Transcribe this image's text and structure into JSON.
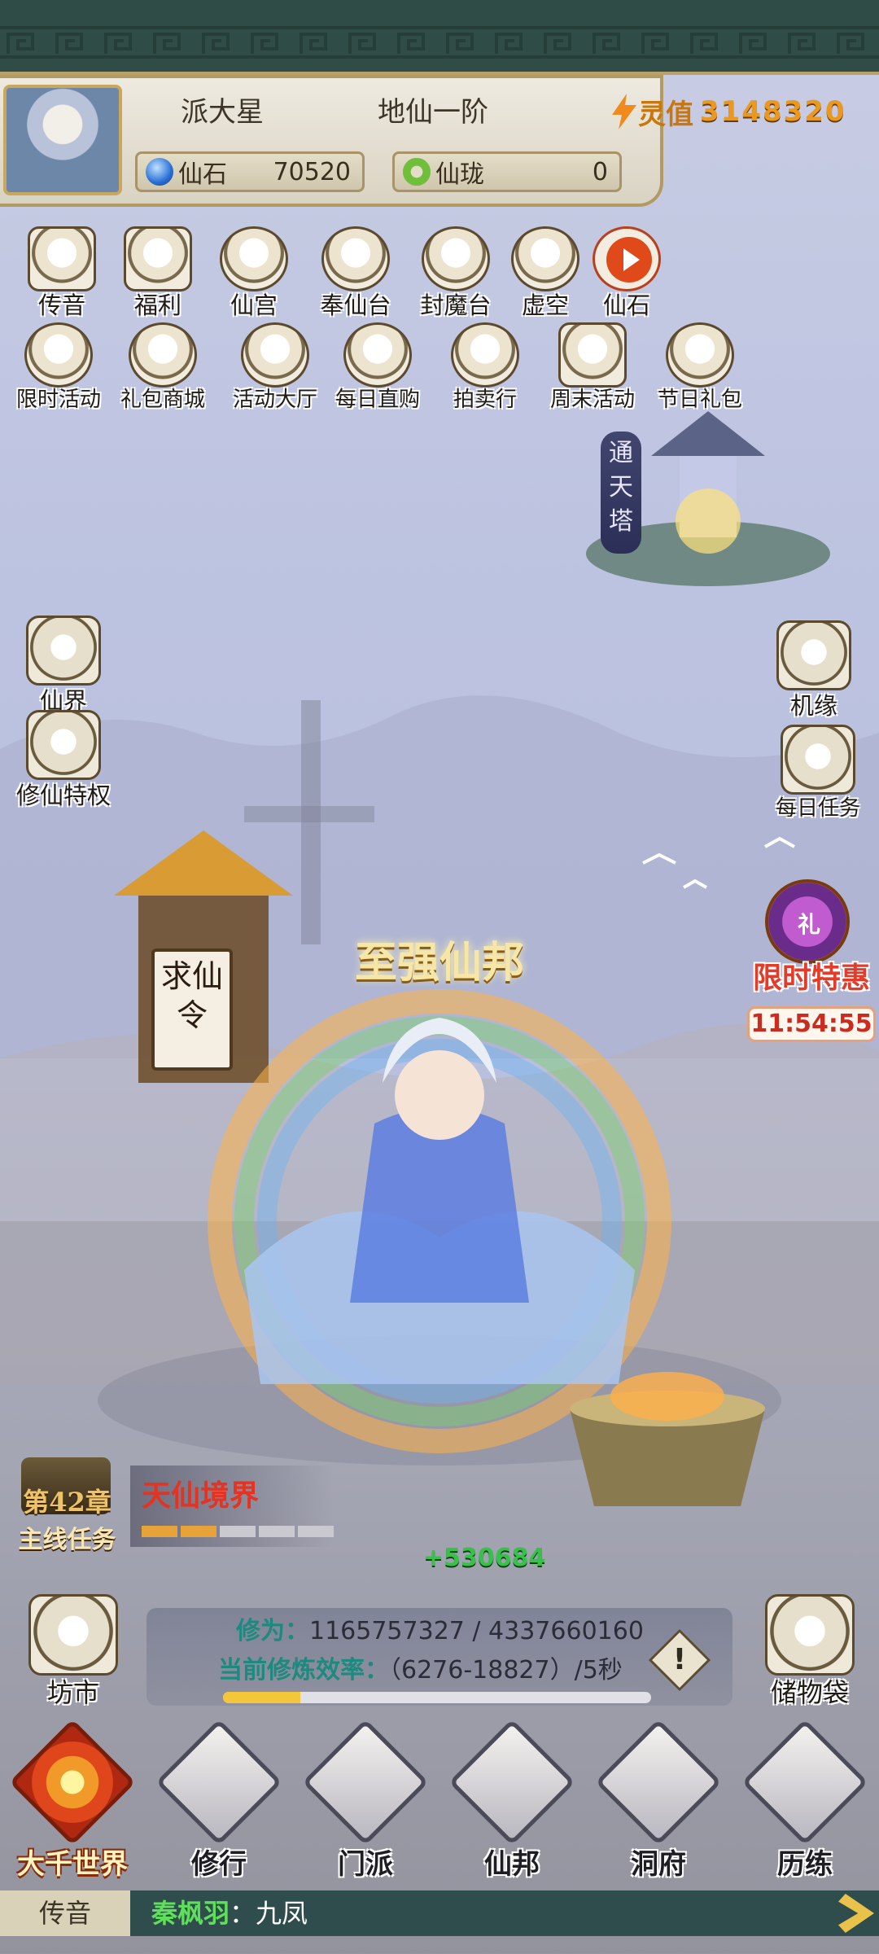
{
  "header": {
    "player_name": "派大星",
    "realm_rank": "地仙一阶",
    "lingzhi_label": "灵值",
    "lingzhi_value": "3148320",
    "xianshi_label": "仙石",
    "xianshi_value": "70520",
    "xianlong_label": "仙珑",
    "xianlong_value": "0"
  },
  "menu_row1": [
    {
      "label": "传音",
      "icon": "envelope-icon"
    },
    {
      "label": "福利",
      "icon": "gift-box-icon"
    },
    {
      "label": "仙宫",
      "icon": "palace-icon"
    },
    {
      "label": "奉仙台",
      "icon": "altar-icon"
    },
    {
      "label": "封魔台",
      "icon": "demon-seal-icon"
    },
    {
      "label": "虚空",
      "icon": "void-atom-icon"
    },
    {
      "label": "仙石",
      "icon": "play-video-icon"
    }
  ],
  "menu_row2": [
    {
      "label": "限时活动",
      "icon": "timed-event-icon"
    },
    {
      "label": "礼包商城",
      "icon": "gift-shop-icon"
    },
    {
      "label": "活动大厅",
      "icon": "event-hall-icon"
    },
    {
      "label": "每日直购",
      "icon": "daily-purchase-icon"
    },
    {
      "label": "拍卖行",
      "icon": "auction-gavel-icon"
    },
    {
      "label": "周末活动",
      "icon": "weekend-icon"
    },
    {
      "label": "节日礼包",
      "icon": "festival-gift-icon"
    }
  ],
  "left_side": [
    {
      "label": "仙界",
      "icon": "immortal-realm-icon"
    },
    {
      "label": "修仙特权",
      "icon": "turtle-privilege-icon"
    }
  ],
  "right_side": [
    {
      "label": "机缘",
      "icon": "gourd-fortune-icon"
    },
    {
      "label": "每日任务",
      "icon": "scroll-task-icon"
    }
  ],
  "tower_label": "通天塔",
  "qiuxian_label": "求仙令",
  "banner_title": "至强仙邦",
  "limited_offer": {
    "label": "限时特惠",
    "timer": "11:54:55",
    "badge": "礼"
  },
  "chapter": {
    "number": "第42章",
    "label": "主线任务"
  },
  "realm_name": "天仙境界",
  "realm_segments": [
    true,
    true,
    false,
    false,
    false
  ],
  "gain_text": "+530684",
  "cultivation": {
    "xiuwei_label": "修为：",
    "xiuwei_value": "1165757327 / 4337660160",
    "rate_label": "当前修炼效率：",
    "rate_value": "（6276-18827）/5秒",
    "progress": 0.18
  },
  "side_buttons": {
    "market": "坊市",
    "storage": "储物袋"
  },
  "bottom_nav": [
    {
      "label": "大千世界",
      "active": true
    },
    {
      "label": "修行",
      "active": false
    },
    {
      "label": "门派",
      "active": false
    },
    {
      "label": "仙邦",
      "active": false
    },
    {
      "label": "洞府",
      "active": false
    },
    {
      "label": "历练",
      "active": false
    }
  ],
  "chat": {
    "tab": "传音",
    "sender": "秦枫羽",
    "message": "：九凤"
  }
}
